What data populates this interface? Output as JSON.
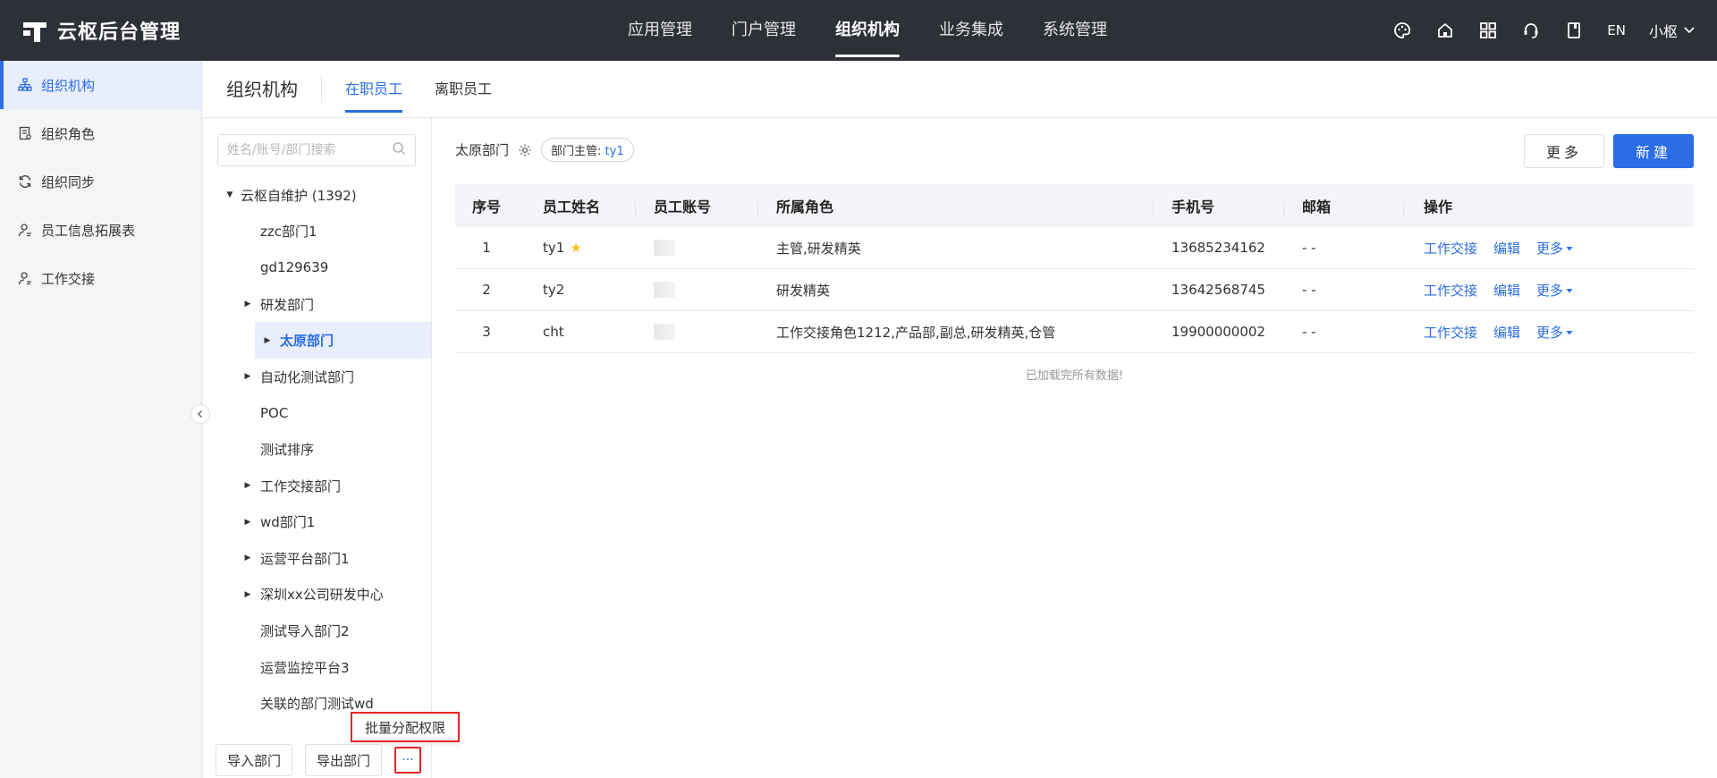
{
  "app": {
    "title": "云枢后台管理"
  },
  "topnav": [
    {
      "label": "应用管理",
      "active": false
    },
    {
      "label": "门户管理",
      "active": false
    },
    {
      "label": "组织机构",
      "active": true
    },
    {
      "label": "业务集成",
      "active": false
    },
    {
      "label": "系统管理",
      "active": false
    }
  ],
  "topright": {
    "lang": "EN",
    "user": "小枢"
  },
  "sidebar": {
    "items": [
      {
        "label": "组织机构",
        "icon": "org-tree-icon",
        "active": true
      },
      {
        "label": "组织角色",
        "icon": "role-doc-icon",
        "active": false
      },
      {
        "label": "组织同步",
        "icon": "sync-icon",
        "active": false
      },
      {
        "label": "员工信息拓展表",
        "icon": "user-icon",
        "active": false
      },
      {
        "label": "工作交接",
        "icon": "user-icon",
        "active": false
      }
    ]
  },
  "header": {
    "title": "组织机构",
    "tabs": [
      {
        "label": "在职员工",
        "active": true
      },
      {
        "label": "离职员工",
        "active": false
      }
    ]
  },
  "tree": {
    "search_placeholder": "姓名/账号/部门搜索",
    "root": "云枢自维护 (1392)",
    "items": [
      {
        "label": "zzc部门1",
        "expandable": false,
        "active": false
      },
      {
        "label": "gd129639",
        "expandable": false,
        "active": false
      },
      {
        "label": "研发部门",
        "expandable": true,
        "active": false
      },
      {
        "label": "太原部门",
        "expandable": true,
        "active": true
      },
      {
        "label": "自动化测试部门",
        "expandable": true,
        "active": false
      },
      {
        "label": "POC",
        "expandable": false,
        "active": false
      },
      {
        "label": "测试排序",
        "expandable": false,
        "active": false
      },
      {
        "label": "工作交接部门",
        "expandable": true,
        "active": false
      },
      {
        "label": "wd部门1",
        "expandable": true,
        "active": false
      },
      {
        "label": "运营平台部门1",
        "expandable": true,
        "active": false
      },
      {
        "label": "深圳xx公司研发中心",
        "expandable": true,
        "active": false
      },
      {
        "label": "测试导入部门2",
        "expandable": false,
        "active": false
      },
      {
        "label": "运营监控平台3",
        "expandable": false,
        "active": false
      },
      {
        "label": "关联的部门测试wd",
        "expandable": false,
        "active": false
      }
    ],
    "import_label": "导入部门",
    "export_label": "导出部门",
    "more_label": "···",
    "popup_label": "批量分配权限"
  },
  "content": {
    "dept_name": "太原部门",
    "manager_prefix": "部门主管:",
    "manager_name": "ty1",
    "more_button": "更多",
    "new_button": "新建",
    "columns": [
      "序号",
      "员工姓名",
      "员工账号",
      "所属角色",
      "手机号",
      "邮箱",
      "操作"
    ],
    "rows": [
      {
        "no": "1",
        "name": "ty1",
        "star": true,
        "roles": "主管,研发精英",
        "phone": "13685234162",
        "email": "- -"
      },
      {
        "no": "2",
        "name": "ty2",
        "star": false,
        "roles": "研发精英",
        "phone": "13642568745",
        "email": "- -"
      },
      {
        "no": "3",
        "name": "cht",
        "star": false,
        "roles": "工作交接角色1212,产品部,副总,研发精英,仓管",
        "phone": "19900000002",
        "email": "- -"
      }
    ],
    "ops": {
      "handover": "工作交接",
      "edit": "编辑",
      "more": "更多"
    },
    "loaded_text": "已加载完所有数据!"
  },
  "colors": {
    "accent": "#2b6de5",
    "topbar": "#2d3037",
    "highlight": "#e8262b",
    "star": "#f5c518"
  }
}
